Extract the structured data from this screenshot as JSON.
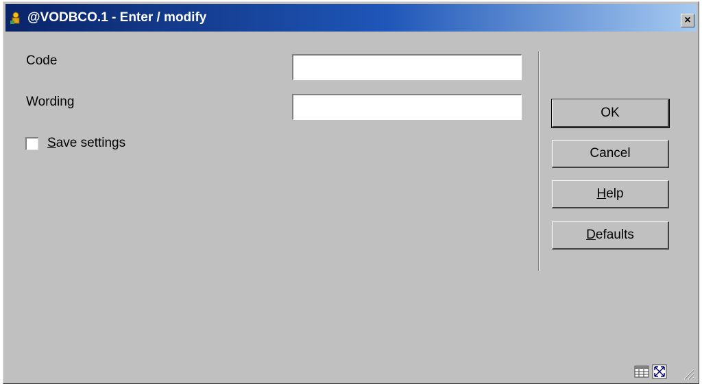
{
  "window": {
    "title": "@VODBCO.1 - Enter / modify",
    "close_label": "×"
  },
  "form": {
    "code_label": "Code",
    "code_value": "",
    "wording_label": "Wording",
    "wording_value": "",
    "save_settings_label": "Save settings",
    "save_settings_checked": false
  },
  "buttons": {
    "ok": "OK",
    "cancel": "Cancel",
    "help": "Help",
    "defaults": "Defaults"
  },
  "status_icons": [
    "table-icon",
    "resize-icon",
    "size-grip-icon"
  ],
  "colors": {
    "titlebar_start": "#0a2468",
    "titlebar_end": "#a6caf0",
    "face": "#c0c0c0"
  }
}
